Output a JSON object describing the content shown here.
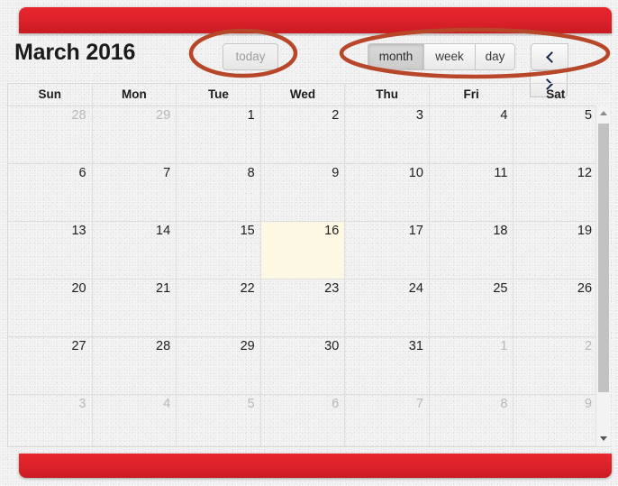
{
  "window": {
    "accent_red": "#e0232b",
    "annotation_color": "#b8472a",
    "today_highlight": "#fdf8e4"
  },
  "header": {
    "title": "March 2016",
    "today_button": {
      "label": "today",
      "state": "disabled"
    },
    "view_buttons": [
      {
        "label": "month",
        "state": "active"
      },
      {
        "label": "week",
        "state": "default"
      },
      {
        "label": "day",
        "state": "default"
      }
    ],
    "nav_buttons": [
      {
        "name": "prev",
        "icon": "chevron-left-icon"
      },
      {
        "name": "next",
        "icon": "chevron-right-icon"
      }
    ]
  },
  "calendar": {
    "day_headers": [
      "Sun",
      "Mon",
      "Tue",
      "Wed",
      "Thu",
      "Fri",
      "Sat"
    ],
    "weeks": [
      [
        {
          "n": "28",
          "other": true
        },
        {
          "n": "29",
          "other": true
        },
        {
          "n": "1"
        },
        {
          "n": "2"
        },
        {
          "n": "3"
        },
        {
          "n": "4"
        },
        {
          "n": "5"
        }
      ],
      [
        {
          "n": "6"
        },
        {
          "n": "7"
        },
        {
          "n": "8"
        },
        {
          "n": "9"
        },
        {
          "n": "10"
        },
        {
          "n": "11"
        },
        {
          "n": "12"
        }
      ],
      [
        {
          "n": "13"
        },
        {
          "n": "14"
        },
        {
          "n": "15"
        },
        {
          "n": "16",
          "today": true
        },
        {
          "n": "17"
        },
        {
          "n": "18"
        },
        {
          "n": "19"
        }
      ],
      [
        {
          "n": "20"
        },
        {
          "n": "21"
        },
        {
          "n": "22"
        },
        {
          "n": "23"
        },
        {
          "n": "24"
        },
        {
          "n": "25"
        },
        {
          "n": "26"
        }
      ],
      [
        {
          "n": "27"
        },
        {
          "n": "28"
        },
        {
          "n": "29"
        },
        {
          "n": "30"
        },
        {
          "n": "31"
        },
        {
          "n": "1",
          "other": true
        },
        {
          "n": "2",
          "other": true
        }
      ],
      [
        {
          "n": "3",
          "other": true
        },
        {
          "n": "4",
          "other": true
        },
        {
          "n": "5",
          "other": true
        },
        {
          "n": "6",
          "other": true
        },
        {
          "n": "7",
          "other": true
        },
        {
          "n": "8",
          "other": true
        },
        {
          "n": "9",
          "other": true
        }
      ]
    ]
  },
  "scrollbar": {
    "up_icon": "scroll-up-arrow-icon",
    "down_icon": "scroll-down-arrow-icon"
  },
  "annotations": [
    {
      "name": "today-button-highlight-ellipse"
    },
    {
      "name": "view-and-nav-buttons-highlight-ellipse"
    }
  ]
}
